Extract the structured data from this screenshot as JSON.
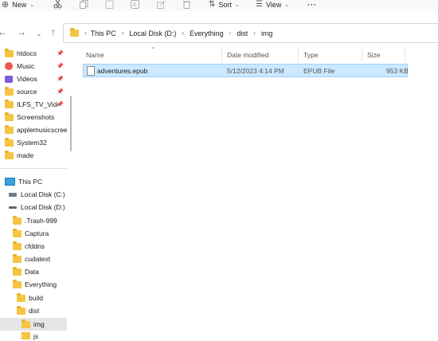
{
  "toolbar": {
    "new_label": "New",
    "sort_label": "Sort",
    "view_label": "View",
    "more_label": "···"
  },
  "nav": {
    "back_icon": "←",
    "forward_icon": "→",
    "up_icon": "↑"
  },
  "address": {
    "crumbs": [
      "This PC",
      "Local Disk (D:)",
      "Everything",
      "dist",
      "img"
    ],
    "separator": "›"
  },
  "sidebar": {
    "quick_access": [
      {
        "label": "htdocs",
        "icon": "folder-icon",
        "pinned": true
      },
      {
        "label": "Music",
        "icon": "music-icon",
        "pinned": true
      },
      {
        "label": "Videos",
        "icon": "videos-icon",
        "pinned": true
      },
      {
        "label": "source",
        "icon": "folder-icon",
        "pinned": true
      },
      {
        "label": "ILFS_TV_Videos",
        "icon": "folder-icon",
        "pinned": true
      },
      {
        "label": "Screenshots",
        "icon": "folder-icon",
        "pinned": false
      },
      {
        "label": "applemusicscreen",
        "icon": "folder-icon",
        "pinned": false
      },
      {
        "label": "System32",
        "icon": "folder-icon",
        "pinned": false
      },
      {
        "label": "made",
        "icon": "folder-icon",
        "pinned": false
      }
    ],
    "this_pc": "This PC",
    "drives": [
      {
        "label": "Local Disk (C:)"
      },
      {
        "label": "Local Disk (D:)"
      }
    ],
    "folders": [
      {
        "label": ".Trash-999"
      },
      {
        "label": "Captura"
      },
      {
        "label": "cfddns"
      },
      {
        "label": "cudatext"
      },
      {
        "label": "Data"
      },
      {
        "label": "Everything"
      },
      {
        "label": "build"
      },
      {
        "label": "dist"
      },
      {
        "label": "img"
      },
      {
        "label": "js"
      }
    ]
  },
  "columns": {
    "name": "Name",
    "date": "Date modified",
    "type": "Type",
    "size": "Size"
  },
  "files": [
    {
      "name": "adventures.epub",
      "date": "5/12/2023 4:14 PM",
      "type": "EPUB File",
      "size": "953 KB"
    }
  ],
  "colors": {
    "selection_bg": "#cce8ff",
    "selection_border": "#99d1ff",
    "folder": "#f5c542",
    "accent": "#0067c0"
  }
}
